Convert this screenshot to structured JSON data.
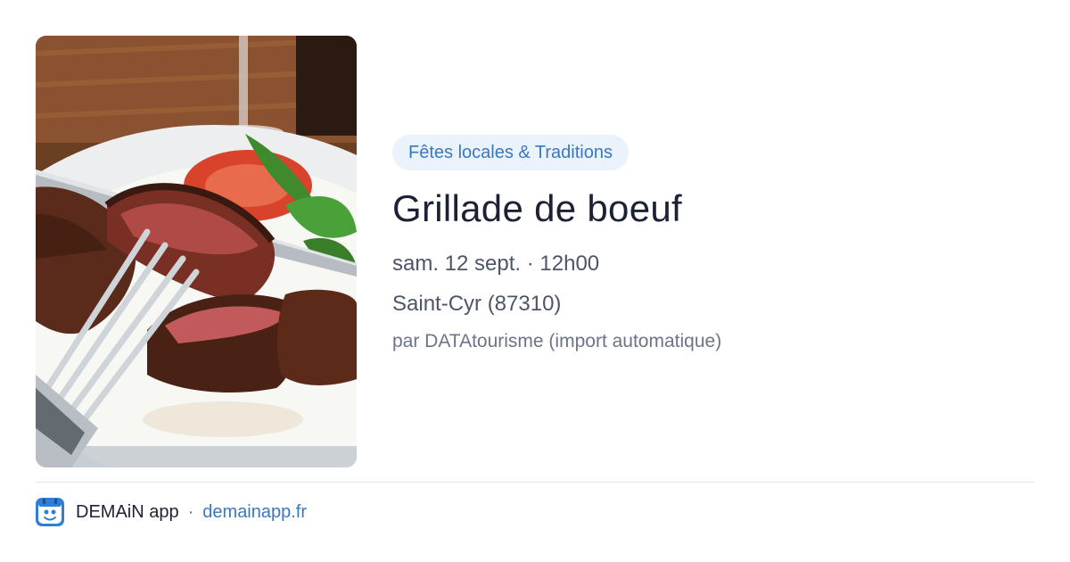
{
  "event": {
    "image_alt": "Steak grillé tranché sur une assiette",
    "category": "Fêtes locales & Traditions",
    "title": "Grillade de boeuf",
    "datetime": "sam. 12 sept. · 12h00",
    "location": "Saint-Cyr (87310)",
    "source": "par DATAtourisme (import automatique)"
  },
  "footer": {
    "app_name": "DEMAiN app",
    "separator": "·",
    "url": "demainapp.fr",
    "logo_icon": "demain-app-logo-icon"
  },
  "colors": {
    "accent": "#3a78c2",
    "badge_bg": "#eaf2fb",
    "title": "#1c2233",
    "text": "#4c5668",
    "muted": "#6a7587",
    "divider": "#dfe6ec"
  }
}
